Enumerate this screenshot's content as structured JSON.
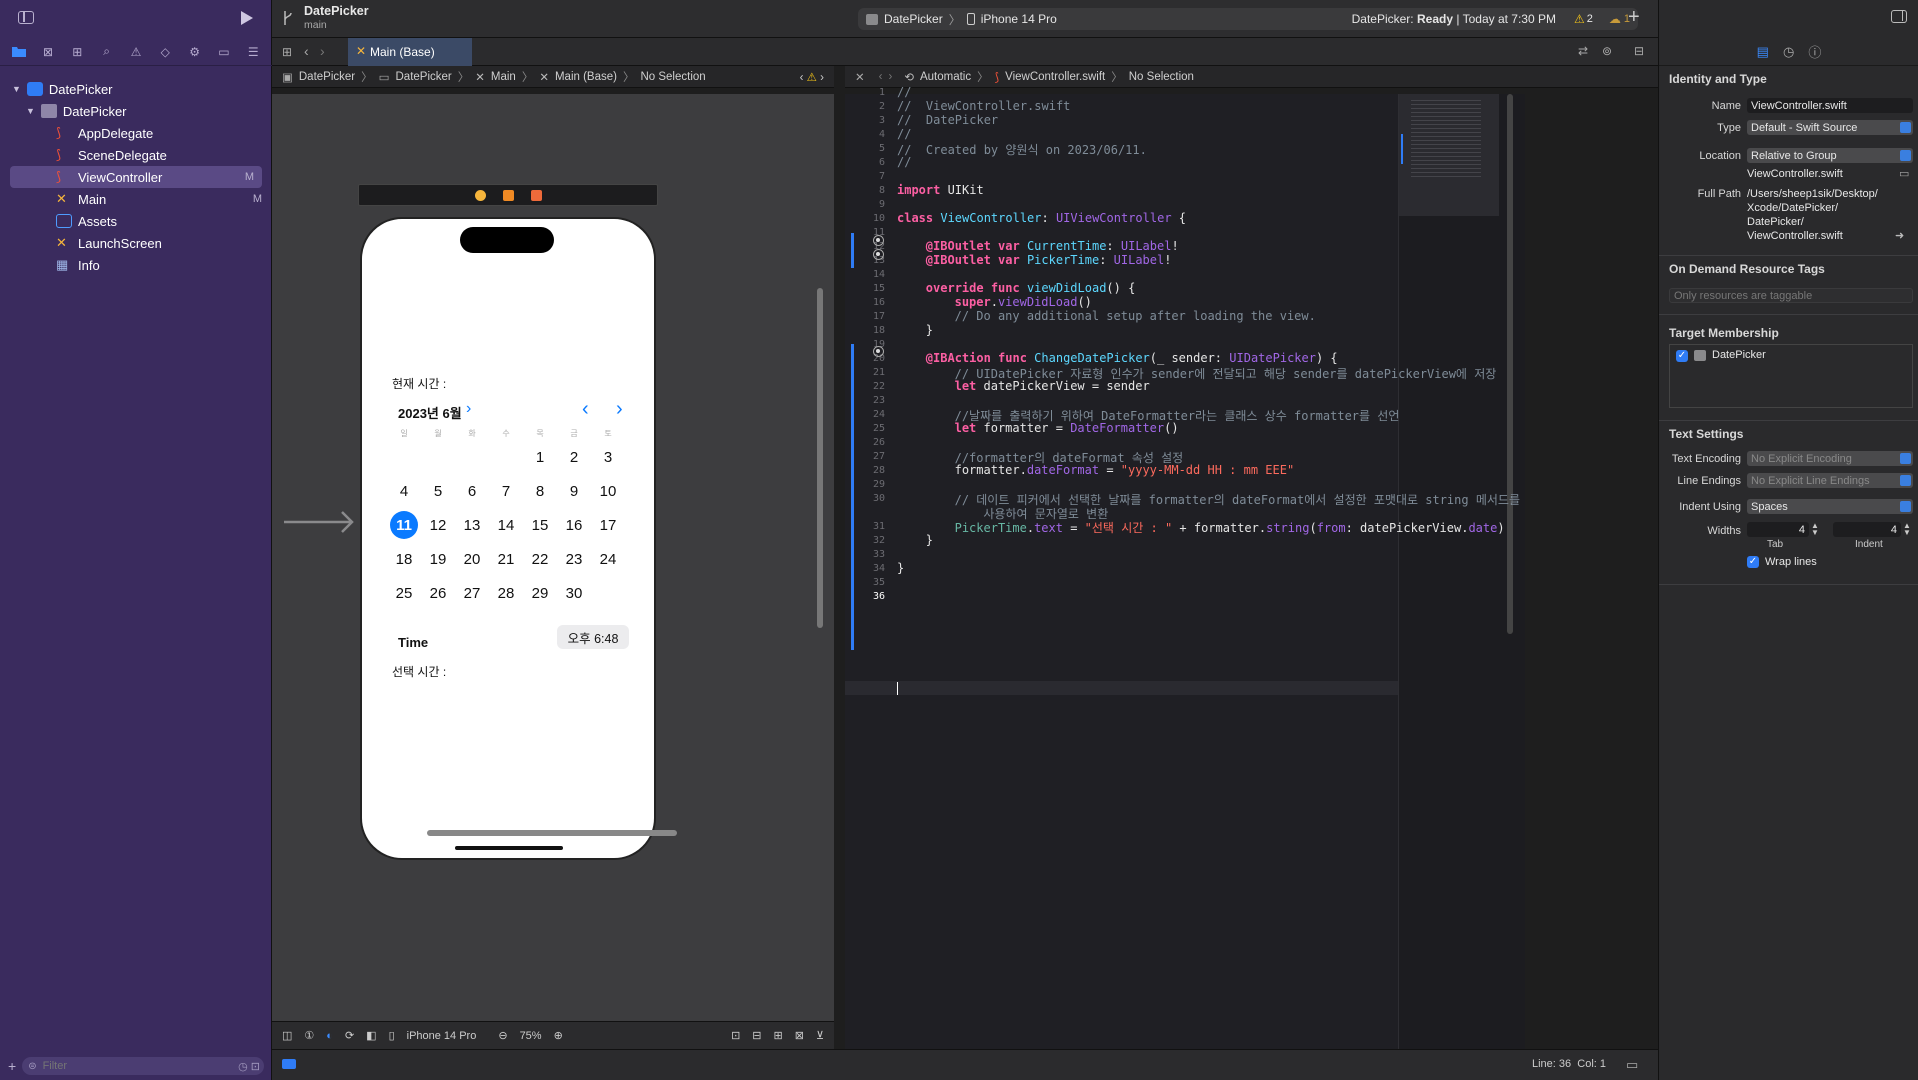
{
  "window": {
    "project": "DatePicker",
    "branch": "main"
  },
  "toolbar": {
    "scheme_name": "DatePicker",
    "device": "iPhone 14 Pro",
    "status_project": "DatePicker:",
    "status_state": "Ready",
    "status_time": "| Today at 7:30 PM",
    "warnings": "2",
    "issues": "1"
  },
  "navigator": {
    "items": [
      {
        "label": "DatePicker",
        "badge": ""
      },
      {
        "label": "DatePicker",
        "badge": ""
      },
      {
        "label": "AppDelegate",
        "badge": ""
      },
      {
        "label": "SceneDelegate",
        "badge": ""
      },
      {
        "label": "ViewController",
        "badge": "M"
      },
      {
        "label": "Main",
        "badge": "M"
      },
      {
        "label": "Assets",
        "badge": ""
      },
      {
        "label": "LaunchScreen",
        "badge": ""
      },
      {
        "label": "Info",
        "badge": ""
      }
    ],
    "filter_placeholder": "Filter"
  },
  "tab": {
    "label": "Main (Base)"
  },
  "ib_breadcrumb": [
    "DatePicker",
    "DatePicker",
    "Main",
    "Main (Base)",
    "No Selection"
  ],
  "editor_breadcrumb": [
    "Automatic",
    "ViewController.swift",
    "No Selection"
  ],
  "storyboard": {
    "current_time_label": "현재 시간 :",
    "month": "2023년 6월",
    "weekdays": [
      "일",
      "월",
      "화",
      "수",
      "목",
      "금",
      "토"
    ],
    "days": [
      "1",
      "2",
      "3",
      "4",
      "5",
      "6",
      "7",
      "8",
      "9",
      "10",
      "11",
      "12",
      "13",
      "14",
      "15",
      "16",
      "17",
      "18",
      "19",
      "20",
      "21",
      "22",
      "23",
      "24",
      "25",
      "26",
      "27",
      "28",
      "29",
      "30"
    ],
    "selected_day": "11",
    "time_label": "Time",
    "time_value": "오후 6:48",
    "picked_time_label": "선택 시간 :",
    "device": "iPhone 14 Pro",
    "zoom": "75%"
  },
  "code": {
    "line_numbers": [
      "1",
      "2",
      "3",
      "4",
      "5",
      "6",
      "7",
      "8",
      "9",
      "10",
      "11",
      "12",
      "13",
      "14",
      "15",
      "16",
      "17",
      "18",
      "19",
      "20",
      "21",
      "22",
      "23",
      "24",
      "25",
      "26",
      "27",
      "28",
      "29",
      "30",
      "",
      "31",
      "32",
      "33",
      "34",
      "35",
      "36"
    ],
    "l1": "//",
    "l2": "//  ViewController.swift",
    "l3": "//  DatePicker",
    "l4": "//",
    "l5": "//  Created by 양원식 on 2023/06/11.",
    "l6": "//",
    "l8a": "import",
    "l8b": " UIKit",
    "l10a": "class",
    "l10b": " ViewController",
    "l10c": ": ",
    "l10d": "UIViewController",
    "l10e": " {",
    "l12a": "@IBOutlet var",
    "l12b": " CurrentTime",
    "l12c": ": ",
    "l12d": "UILabel",
    "l12e": "!",
    "l13a": "@IBOutlet var",
    "l13b": " PickerTime",
    "l13c": ": ",
    "l13d": "UILabel",
    "l13e": "!",
    "l15a": "override func",
    "l15b": " viewDidLoad",
    "l15c": "() {",
    "l16a": "super",
    "l16b": ".",
    "l16c": "viewDidLoad",
    "l16d": "()",
    "l17": "// Do any additional setup after loading the view.",
    "l18": "}",
    "l20a": "@IBAction func",
    "l20b": " ChangeDatePicker",
    "l20c": "(_ sender: ",
    "l20d": "UIDatePicker",
    "l20e": ") {",
    "l21": "// UIDatePicker 자료형 인수가 sender에 전달되고 해당 sender를 datePickerView에 저장",
    "l22a": "let",
    "l22b": " datePickerView = sender",
    "l24": "//날짜를 출력하기 위하여 DateFormatter라는 클래스 상수 formatter를 선언",
    "l25a": "let",
    "l25b": " formatter = ",
    "l25c": "DateFormatter",
    "l25d": "()",
    "l27": "//formatter의 dateFormat 속성 설정",
    "l28a": "formatter.",
    "l28b": "dateFormat",
    "l28c": " = ",
    "l28d": "\"yyyy-MM-dd HH : mm EEE\"",
    "l30a": "// 데이트 피커에서 선택한 날짜를 formatter의 dateFormat에서 설정한 포맷대로 string 메서드를",
    "l30b": "사용하여 문자열로 변환",
    "l31a": "PickerTime",
    "l31b": ".",
    "l31c": "text",
    "l31d": " = ",
    "l31e": "\"선택 시간 : \"",
    "l31f": " + formatter.",
    "l31g": "string",
    "l31h": "(",
    "l31i": "from",
    "l31j": ": datePickerView.",
    "l31k": "date",
    "l31l": ")",
    "l32": "}",
    "l34": "}"
  },
  "status": {
    "line": "Line: 36",
    "col": "Col: 1"
  },
  "inspector": {
    "identity_title": "Identity and Type",
    "name_label": "Name",
    "name_value": "ViewController.swift",
    "type_label": "Type",
    "type_value": "Default - Swift Source",
    "location_label": "Location",
    "location_value": "Relative to Group",
    "location_file": "ViewController.swift",
    "fullpath_label": "Full Path",
    "fullpath_lines": [
      "/Users/sheep1sik/Desktop/",
      "Xcode/DatePicker/",
      "DatePicker/",
      "ViewController.swift"
    ],
    "odr_title": "On Demand Resource Tags",
    "odr_placeholder": "Only resources are taggable",
    "target_title": "Target Membership",
    "target_name": "DatePicker",
    "text_title": "Text Settings",
    "encoding_label": "Text Encoding",
    "encoding_value": "No Explicit Encoding",
    "endings_label": "Line Endings",
    "endings_value": "No Explicit Line Endings",
    "indent_label": "Indent Using",
    "indent_value": "Spaces",
    "widths_label": "Widths",
    "tab_value": "4",
    "tab_label": "Tab",
    "indent_value_n": "4",
    "indent_label2": "Indent",
    "wrap_label": "Wrap lines"
  }
}
